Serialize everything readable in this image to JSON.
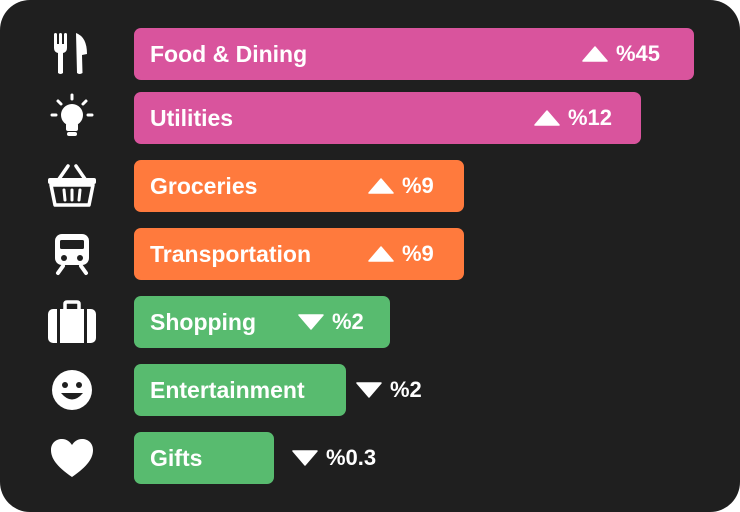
{
  "colors": {
    "background": "#1f1f1f",
    "pink": "#d9549d",
    "orange": "#ff7a3d",
    "green": "#58bb6f",
    "text": "#ffffff"
  },
  "categories": [
    {
      "label": "Food & Dining",
      "icon": "fork-knife-icon",
      "change": "%45",
      "direction": "up",
      "color": "pink",
      "value": 45
    },
    {
      "label": "Utilities",
      "icon": "lightbulb-icon",
      "change": "%12",
      "direction": "up",
      "color": "pink",
      "value": 12
    },
    {
      "label": "Groceries",
      "icon": "basket-icon",
      "change": "%9",
      "direction": "up",
      "color": "orange",
      "value": 9
    },
    {
      "label": "Transportation",
      "icon": "train-icon",
      "change": "%9",
      "direction": "up",
      "color": "orange",
      "value": 9
    },
    {
      "label": "Shopping",
      "icon": "suitcase-icon",
      "change": "%2",
      "direction": "down",
      "color": "green",
      "value": 2
    },
    {
      "label": "Entertainment",
      "icon": "smiley-icon",
      "change": "%2",
      "direction": "down",
      "color": "green",
      "value": 2
    },
    {
      "label": "Gifts",
      "icon": "heart-icon",
      "change": "%0.3",
      "direction": "down",
      "color": "green",
      "value": 0.3
    }
  ]
}
